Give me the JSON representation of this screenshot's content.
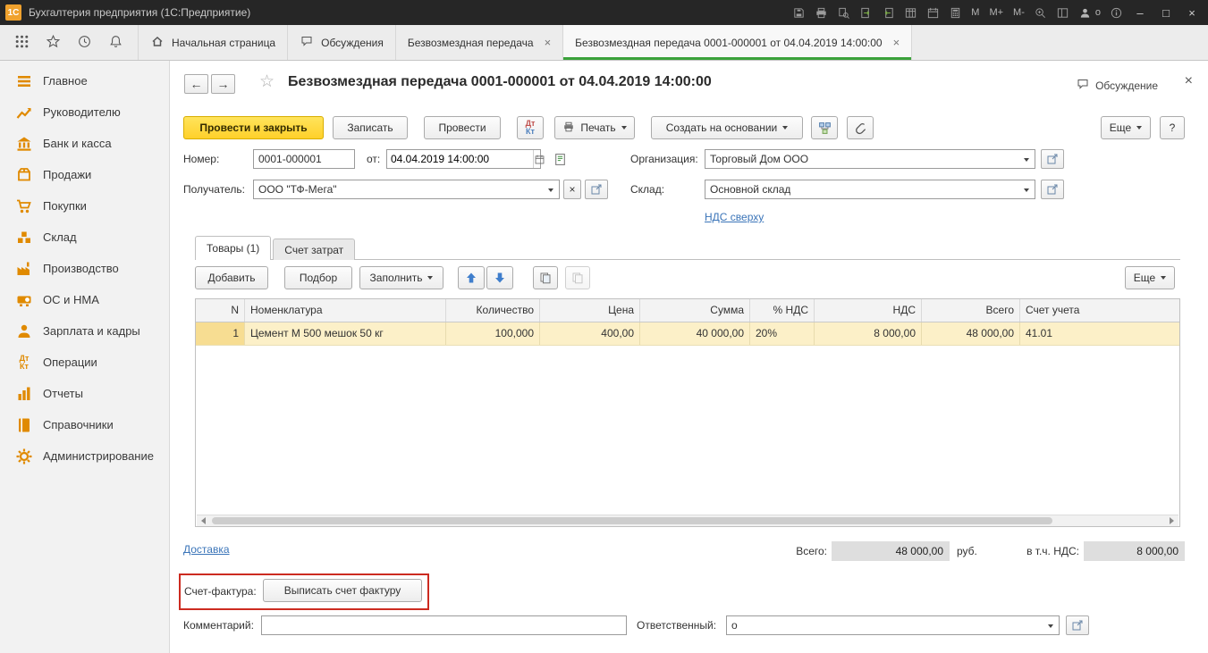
{
  "window": {
    "logo": "1С",
    "title": "Бухгалтерия предприятия (1С:Предприятие)",
    "memory": [
      "M",
      "M+",
      "M-"
    ],
    "user": "о"
  },
  "icons": {
    "back": "←",
    "forward": "→",
    "favorite": "☆",
    "close": "×",
    "minimize": "–",
    "maximize": "□",
    "help": "?"
  },
  "tabbar": {
    "tabs": [
      "Начальная страница",
      "Обсуждения",
      "Безвозмездная передача",
      "Безвозмездная передача 0001-000001 от 04.04.2019 14:00:00"
    ]
  },
  "sidebar": {
    "items": [
      "Главное",
      "Руководителю",
      "Банк и касса",
      "Продажи",
      "Покупки",
      "Склад",
      "Производство",
      "ОС и НМА",
      "Зарплата и кадры",
      "Операции",
      "Отчеты",
      "Справочники",
      "Администрирование"
    ]
  },
  "document": {
    "title": "Безвозмездная передача 0001-000001 от 04.04.2019 14:00:00",
    "discussion": "Обсуждение",
    "toolbar": {
      "post_and_close": "Провести и закрыть",
      "write": "Записать",
      "post": "Провести",
      "dt": "Дт",
      "kt": "Кт",
      "print": "Печать",
      "create_on_base": "Создать на основании",
      "more": "Еще"
    },
    "fields": {
      "number_label": "Номер:",
      "number_value": "0001-000001",
      "date_label": "от:",
      "date_value": "04.04.2019 14:00:00",
      "org_label": "Организация:",
      "org_value": "Торговый Дом ООО",
      "recipient_label": "Получатель:",
      "recipient_value": "ООО \"ТФ-Мега\"",
      "warehouse_label": "Склад:",
      "warehouse_value": "Основной склад",
      "vat_mode": "НДС сверху"
    },
    "page_tabs": {
      "goods": "Товары (1)",
      "cost": "Счет затрат"
    },
    "grid_toolbar": {
      "add": "Добавить",
      "pick": "Подбор",
      "fill": "Заполнить",
      "more": "Еще"
    },
    "table": {
      "columns": [
        "N",
        "Номенклатура",
        "Количество",
        "Цена",
        "Сумма",
        "% НДС",
        "НДС",
        "Всего",
        "Счет учета"
      ],
      "row": {
        "n": "1",
        "nomenclature": "Цемент М 500 мешок 50 кг",
        "qty": "100,000",
        "price": "400,00",
        "sum": "40 000,00",
        "vat_pct": "20%",
        "vat": "8 000,00",
        "total": "48 000,00",
        "account": "41.01"
      }
    },
    "footer": {
      "delivery": "Доставка",
      "total_label": "Всего:",
      "total_value": "48 000,00",
      "currency": "руб.",
      "incl_vat_label": "в т.ч. НДС:",
      "incl_vat_value": "8 000,00",
      "invoice_label": "Счет-фактура:",
      "invoice_button": "Выписать счет фактуру",
      "comment_label": "Комментарий:",
      "comment_value": "",
      "responsible_label": "Ответственный:",
      "responsible_value": "о"
    }
  }
}
